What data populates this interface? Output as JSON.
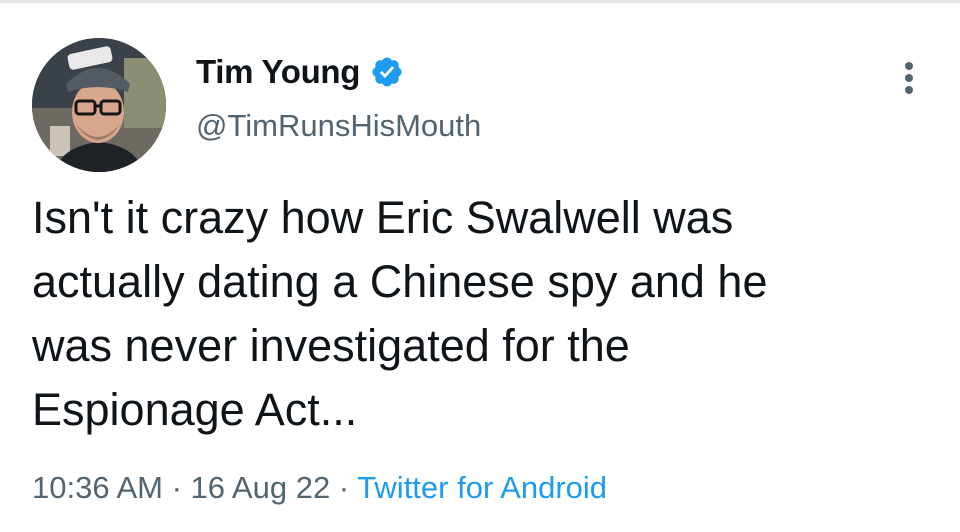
{
  "tweet": {
    "author": {
      "display_name": "Tim Young",
      "handle": "@TimRunsHisMouth",
      "verified": true,
      "avatar_icon": "user-avatar-photo"
    },
    "more_icon": "more-vertical-icon",
    "text_lines": [
      "Isn't it crazy how Eric Swalwell was",
      "actually dating a Chinese spy and he",
      "was never investigated for the",
      "Espionage Act..."
    ],
    "meta": {
      "time": "10:36 AM",
      "separator": " · ",
      "date": "16 Aug 22",
      "source": "Twitter for Android"
    },
    "colors": {
      "text": "#0f1419",
      "secondary": "#536471",
      "accent": "#1d9bf0"
    }
  }
}
